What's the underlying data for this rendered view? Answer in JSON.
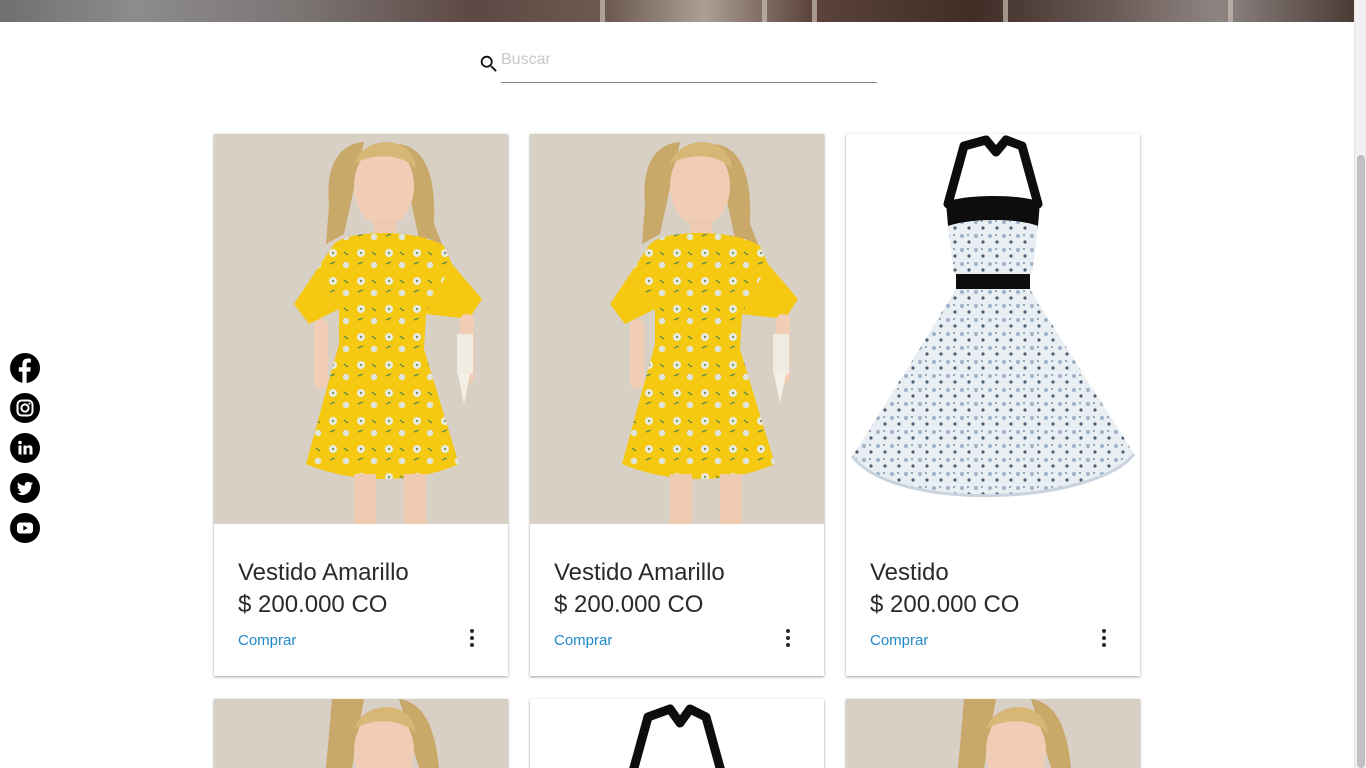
{
  "search": {
    "placeholder": "Buscar",
    "value": ""
  },
  "social": [
    {
      "name": "facebook-icon",
      "glyph": "f"
    },
    {
      "name": "instagram-icon",
      "glyph": ""
    },
    {
      "name": "linkedin-icon",
      "glyph": "in"
    },
    {
      "name": "twitter-icon",
      "glyph": ""
    },
    {
      "name": "youtube-icon",
      "glyph": ""
    }
  ],
  "products": [
    {
      "title": "Vestido Amarillo",
      "price": "$ 200.000 CO",
      "action": "Comprar",
      "image": "yellow-floral-dress"
    },
    {
      "title": "Vestido Amarillo",
      "price": "$ 200.000 CO",
      "action": "Comprar",
      "image": "yellow-floral-dress"
    },
    {
      "title": "Vestido",
      "price": "$ 200.000 CO",
      "action": "Comprar",
      "image": "blue-floral-halter-dress"
    },
    {
      "title": "",
      "price": "",
      "action": "",
      "image": "yellow-floral-dress"
    },
    {
      "title": "",
      "price": "",
      "action": "",
      "image": "blue-floral-halter-dress"
    },
    {
      "title": "",
      "price": "",
      "action": "",
      "image": "yellow-floral-dress"
    }
  ],
  "colors": {
    "link": "#1e88c8",
    "text": "#2a2a2a",
    "dress_yellow": "#f5c812",
    "photo_bg": "#d8d0c5"
  }
}
